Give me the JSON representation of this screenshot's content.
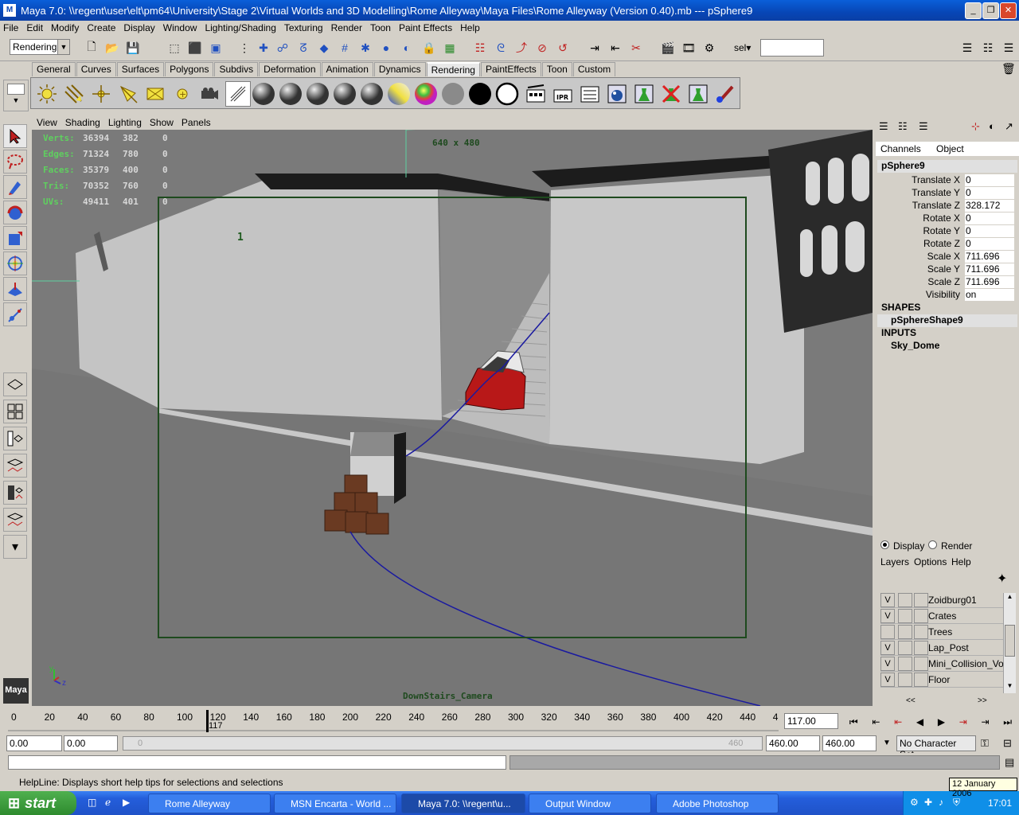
{
  "window": {
    "title": "Maya 7.0: \\\\regent\\user\\elt\\pm64\\University\\Stage 2\\Virtual Worlds and 3D Modelling\\Rome Alleyway\\Maya Files\\Rome Alleyway (Version 0.40).mb   ---   pSphere9",
    "min": "_",
    "max": "❐",
    "close": "✕"
  },
  "menu": [
    "File",
    "Edit",
    "Modify",
    "Create",
    "Display",
    "Window",
    "Lighting/Shading",
    "Texturing",
    "Render",
    "Toon",
    "Paint Effects",
    "Help"
  ],
  "status": {
    "menu_set": "Rendering",
    "sel_label": "sel▾",
    "sel_value": ""
  },
  "shelf_tabs": [
    "General",
    "Curves",
    "Surfaces",
    "Polygons",
    "Subdivs",
    "Deformation",
    "Animation",
    "Dynamics",
    "Rendering",
    "PaintEffects",
    "Toon",
    "Custom"
  ],
  "active_tab": "Rendering",
  "viewport": {
    "menu": [
      "View",
      "Shading",
      "Lighting",
      "Show",
      "Panels"
    ],
    "resolution": "640 x 480",
    "camera": "DownStairs_Camera",
    "frame_label": "1",
    "hud": [
      {
        "label": "Verts:",
        "a": "36394",
        "b": "382",
        "c": "0"
      },
      {
        "label": "Edges:",
        "a": "71324",
        "b": "780",
        "c": "0"
      },
      {
        "label": "Faces:",
        "a": "35379",
        "b": "400",
        "c": "0"
      },
      {
        "label": "Tris:",
        "a": "70352",
        "b": "760",
        "c": "0"
      },
      {
        "label": "UVs:",
        "a": "49411",
        "b": "401",
        "c": "0"
      }
    ],
    "axis_y": "y",
    "axis_z": "z"
  },
  "channel_box": {
    "tabs": [
      "Channels",
      "Object"
    ],
    "object": "pSphere9",
    "channels": [
      {
        "name": "Translate X",
        "value": "0"
      },
      {
        "name": "Translate Y",
        "value": "0"
      },
      {
        "name": "Translate Z",
        "value": "328.172"
      },
      {
        "name": "Rotate X",
        "value": "0"
      },
      {
        "name": "Rotate Y",
        "value": "0"
      },
      {
        "name": "Rotate Z",
        "value": "0"
      },
      {
        "name": "Scale X",
        "value": "711.696"
      },
      {
        "name": "Scale Y",
        "value": "711.696"
      },
      {
        "name": "Scale Z",
        "value": "711.696"
      },
      {
        "name": "Visibility",
        "value": "on"
      }
    ],
    "shapes_label": "SHAPES",
    "shape": "pSphereShape9",
    "inputs_label": "INPUTS",
    "input": "Sky_Dome"
  },
  "layers": {
    "display_label": "Display",
    "render_label": "Render",
    "menu": [
      "Layers",
      "Options",
      "Help"
    ],
    "rows": [
      {
        "v": "V",
        "name": "Zoidburg01"
      },
      {
        "v": "V",
        "name": "Crates"
      },
      {
        "v": "",
        "name": "Trees"
      },
      {
        "v": "V",
        "name": "Lap_Post"
      },
      {
        "v": "V",
        "name": "Mini_Collision_Volume"
      },
      {
        "v": "V",
        "name": "Floor"
      }
    ],
    "scroll_left": "<<",
    "scroll_right": ">>"
  },
  "time_slider": {
    "ticks": [
      "0",
      "20",
      "40",
      "60",
      "80",
      "100",
      "120",
      "140",
      "160",
      "180",
      "200",
      "220",
      "240",
      "260",
      "280",
      "300",
      "320",
      "340",
      "360",
      "380",
      "400",
      "420",
      "440",
      "4"
    ],
    "current_frame_marker": "117",
    "current_time": "117.00"
  },
  "range_slider": {
    "start": "0.00",
    "playback_start": "0.00",
    "range_start_label": "0",
    "range_end_label": "460",
    "playback_end": "460.00",
    "end": "460.00",
    "character_set": "No Character Set"
  },
  "helpline": "HelpLine: Displays short help tips for selections and selections",
  "taskbar": {
    "start": "start",
    "tasks": [
      "Rome Alleyway",
      "MSN Encarta - World ...",
      "Maya 7.0: \\\\regent\\u...",
      "Output Window",
      "Adobe Photoshop"
    ],
    "active_task": 2,
    "clock": "17:01",
    "date_tooltip": "12 January 2006"
  }
}
